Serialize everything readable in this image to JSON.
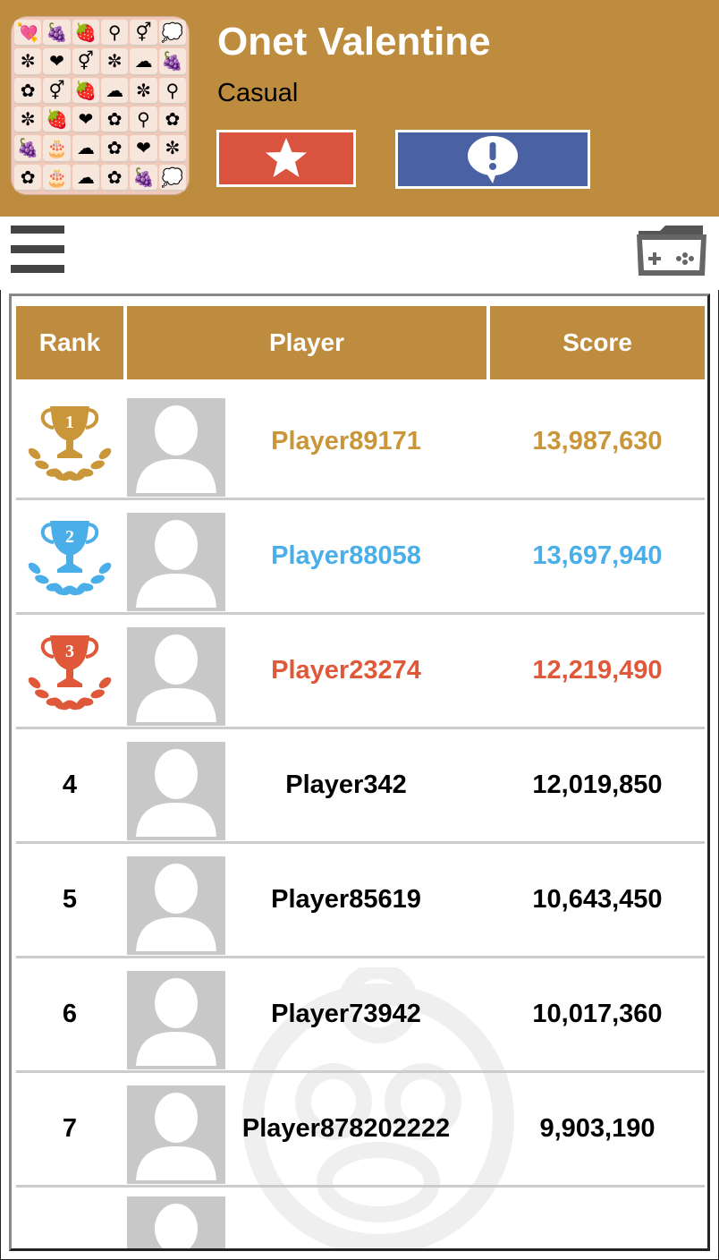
{
  "app": {
    "title": "Onet Valentine",
    "category": "Casual"
  },
  "colors": {
    "brand": "#bd8c3e",
    "favorite": "#d9533f",
    "report": "#4a62a3",
    "gold": "#c9963a",
    "silver_blue": "#4aaee8",
    "bronze_red": "#e0583a"
  },
  "icons": {
    "favorite": "star-icon",
    "report": "exclamation-bubble-icon",
    "menu": "hamburger-menu-icon",
    "games": "game-folder-icon"
  },
  "leaderboard": {
    "headers": {
      "rank": "Rank",
      "player": "Player",
      "score": "Score"
    },
    "rows": [
      {
        "rank": "1",
        "player": "Player89171",
        "score": "13,987,630",
        "medal": "gold"
      },
      {
        "rank": "2",
        "player": "Player88058",
        "score": "13,697,940",
        "medal": "silver_blue"
      },
      {
        "rank": "3",
        "player": "Player23274",
        "score": "12,219,490",
        "medal": "bronze_red"
      },
      {
        "rank": "4",
        "player": "Player342",
        "score": "12,019,850"
      },
      {
        "rank": "5",
        "player": "Player85619",
        "score": "10,643,450"
      },
      {
        "rank": "6",
        "player": "Player73942",
        "score": "10,017,360"
      },
      {
        "rank": "7",
        "player": "Player878202222",
        "score": "9,903,190"
      }
    ]
  }
}
